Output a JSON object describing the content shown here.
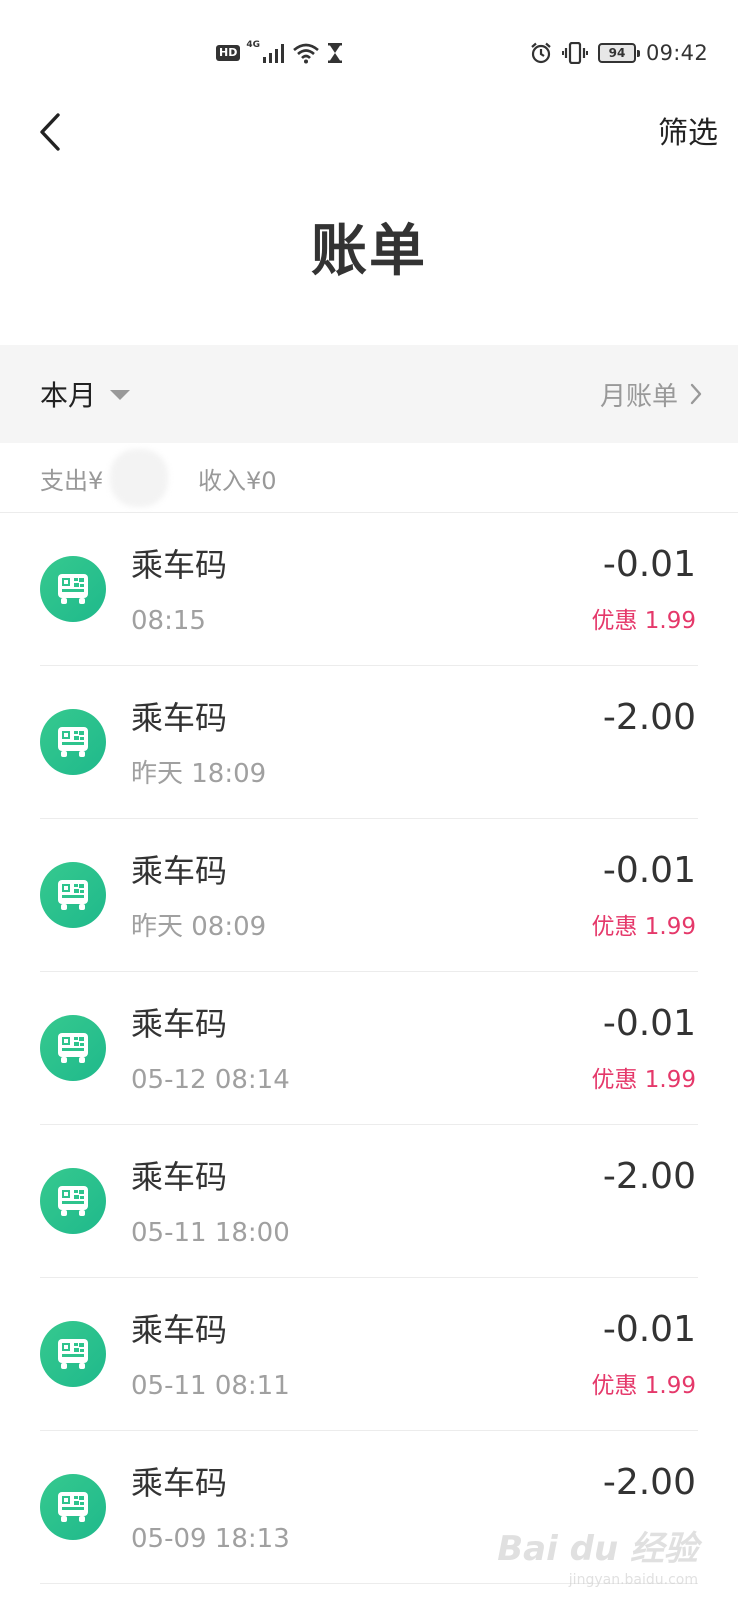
{
  "status_bar": {
    "hd": "HD",
    "network": "4G",
    "battery": "94",
    "time": "09:42",
    "icons": [
      "signal-icon",
      "wifi-icon",
      "hourglass-icon",
      "alarm-icon",
      "vibrate-icon"
    ]
  },
  "header": {
    "filter": "筛选",
    "title": "账单"
  },
  "month_bar": {
    "month": "本月",
    "monthly_bill": "月账单"
  },
  "summary": {
    "expense": "支出¥",
    "income": "收入¥0"
  },
  "transactions": [
    {
      "title": "乘车码",
      "time": "08:15",
      "amount": "-0.01",
      "discount": "优惠 1.99"
    },
    {
      "title": "乘车码",
      "time": "昨天 18:09",
      "amount": "-2.00",
      "discount": ""
    },
    {
      "title": "乘车码",
      "time": "昨天 08:09",
      "amount": "-0.01",
      "discount": "优惠 1.99"
    },
    {
      "title": "乘车码",
      "time": "05-12 08:14",
      "amount": "-0.01",
      "discount": "优惠 1.99"
    },
    {
      "title": "乘车码",
      "time": "05-11 18:00",
      "amount": "-2.00",
      "discount": ""
    },
    {
      "title": "乘车码",
      "time": "05-11 08:11",
      "amount": "-0.01",
      "discount": "优惠 1.99"
    },
    {
      "title": "乘车码",
      "time": "05-09 18:13",
      "amount": "-2.00",
      "discount": ""
    }
  ],
  "watermark": {
    "main": "Bai du 经验",
    "sub": "jingyan.baidu.com"
  },
  "colors": {
    "accent_green": "#2ec48d",
    "discount_red": "#e5386a",
    "muted_text": "#999999",
    "band_background": "#f5f5f5"
  }
}
